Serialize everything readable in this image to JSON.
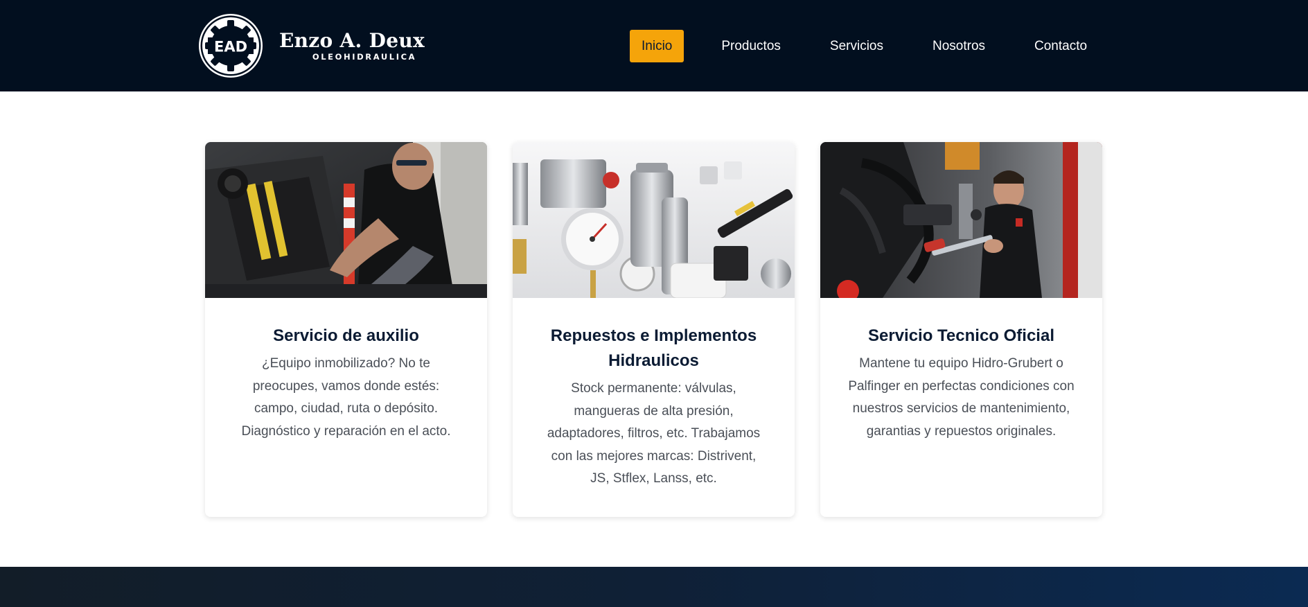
{
  "brand": {
    "badge": "EAD",
    "name": "Enzo A. Deux",
    "tagline": "OLEOHIDRAULICA"
  },
  "nav": {
    "items": [
      {
        "label": "Inicio",
        "active": true
      },
      {
        "label": "Productos",
        "active": false
      },
      {
        "label": "Servicios",
        "active": false
      },
      {
        "label": "Nosotros",
        "active": false
      },
      {
        "label": "Contacto",
        "active": false
      }
    ]
  },
  "colors": {
    "header_bg": "#020f1f",
    "accent": "#f5a40a",
    "title_text": "#0b1b33",
    "body_text": "#4a4f57"
  },
  "cards": [
    {
      "title": "Servicio de auxilio",
      "description": "¿Equipo inmobilizado? No te preocupes, vamos donde estés: campo, ciudad, ruta o depósito. Diagnóstico y reparación en el acto.",
      "image": "mechanic-repairing-machine-photo"
    },
    {
      "title": "Repuestos e Implementos Hidraulicos",
      "description": "Stock permanente: válvulas, mangueras de alta presión, adaptadores, filtros, etc. Trabajamos con las mejores marcas: Distrivent, JS, Stflex, Lanss, etc.",
      "image": "hydraulic-parts-photo"
    },
    {
      "title": "Servicio Tecnico Oficial",
      "description": "Mantene tu equipo Hidro-Grubert o Palfinger en perfectas condiciones con nuestros servicios de mantenimiento, garantias y repuestos originales.",
      "image": "technician-greasing-crane-photo"
    }
  ]
}
